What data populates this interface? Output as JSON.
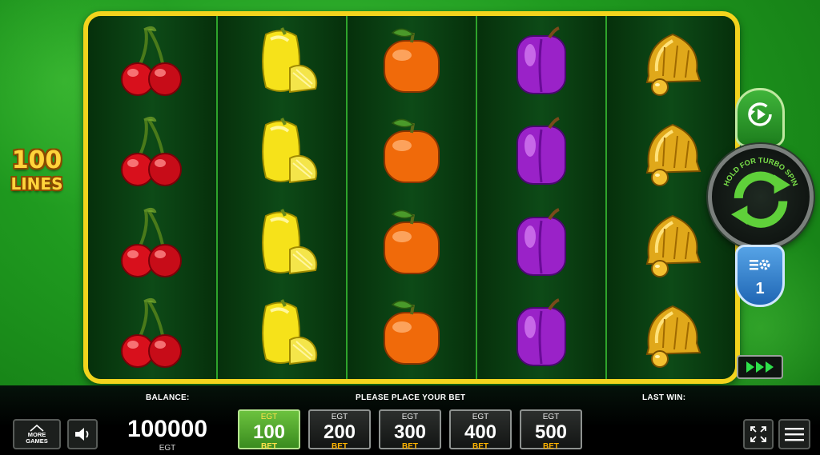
{
  "game": {
    "lines_number": "100",
    "lines_word": "LINES",
    "reels": [
      {
        "symbol": "cherry-icon"
      },
      {
        "symbol": "lemon-icon"
      },
      {
        "symbol": "orange-icon"
      },
      {
        "symbol": "plum-icon"
      },
      {
        "symbol": "bell-icon"
      }
    ],
    "rows": 4
  },
  "controls": {
    "spin_hint": "HOLD FOR TURBO SPIN",
    "lines_value": "1"
  },
  "bottom_bar": {
    "more_games_line1": "MORE",
    "more_games_line2": "GAMES",
    "balance_label": "BALANCE:",
    "balance_value": "100000",
    "balance_currency": "EGT",
    "bet_prompt": "PLEASE PLACE YOUR BET",
    "last_win_label": "LAST WIN:",
    "bets": [
      {
        "currency": "EGT",
        "value": "100",
        "label": "BET",
        "selected": true
      },
      {
        "currency": "EGT",
        "value": "200",
        "label": "BET",
        "selected": false
      },
      {
        "currency": "EGT",
        "value": "300",
        "label": "BET",
        "selected": false
      },
      {
        "currency": "EGT",
        "value": "400",
        "label": "BET",
        "selected": false
      },
      {
        "currency": "EGT",
        "value": "500",
        "label": "BET",
        "selected": false
      }
    ]
  },
  "colors": {
    "frame": "#f2d41d",
    "background": "#1f9a1f",
    "selected_bet": "#4fa42c",
    "bet_label": "#ffb300"
  }
}
